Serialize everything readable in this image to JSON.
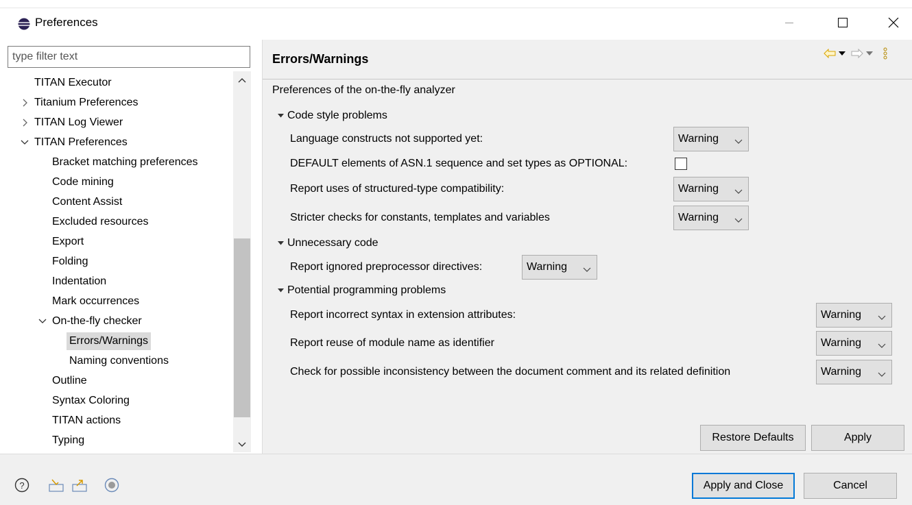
{
  "window": {
    "title": "Preferences",
    "icon": "eclipse-icon",
    "controls": [
      "minimize-icon",
      "maximize-icon",
      "close-icon"
    ]
  },
  "filter": {
    "placeholder": "type filter text",
    "value": ""
  },
  "tree": {
    "items": [
      {
        "label": "TITAN Executor",
        "level": 1,
        "twisty": "none"
      },
      {
        "label": "Titanium Preferences",
        "level": 1,
        "twisty": "collapsed"
      },
      {
        "label": "TITAN Log Viewer",
        "level": 1,
        "twisty": "collapsed"
      },
      {
        "label": "TITAN Preferences",
        "level": 1,
        "twisty": "expanded"
      },
      {
        "label": "Bracket matching preferences",
        "level": 2,
        "twisty": "none"
      },
      {
        "label": "Code mining",
        "level": 2,
        "twisty": "none"
      },
      {
        "label": "Content Assist",
        "level": 2,
        "twisty": "none"
      },
      {
        "label": "Excluded resources",
        "level": 2,
        "twisty": "none"
      },
      {
        "label": "Export",
        "level": 2,
        "twisty": "none"
      },
      {
        "label": "Folding",
        "level": 2,
        "twisty": "none"
      },
      {
        "label": "Indentation",
        "level": 2,
        "twisty": "none"
      },
      {
        "label": "Mark occurrences",
        "level": 2,
        "twisty": "none"
      },
      {
        "label": "On-the-fly checker",
        "level": 2,
        "twisty": "expanded"
      },
      {
        "label": "Errors/Warnings",
        "level": 3,
        "twisty": "none",
        "selected": true
      },
      {
        "label": "Naming conventions",
        "level": 3,
        "twisty": "none"
      },
      {
        "label": "Outline",
        "level": 2,
        "twisty": "none"
      },
      {
        "label": "Syntax Coloring",
        "level": 2,
        "twisty": "none"
      },
      {
        "label": "TITAN actions",
        "level": 2,
        "twisty": "none"
      },
      {
        "label": "Typing",
        "level": 2,
        "twisty": "none"
      }
    ]
  },
  "page": {
    "title": "Errors/Warnings",
    "description": "Preferences of the on-the-fly analyzer",
    "nav_icons": [
      "back-arrow-icon",
      "back-menu-icon",
      "forward-arrow-icon",
      "forward-menu-icon",
      "view-menu-icon"
    ],
    "sections": [
      {
        "title": "Code style problems",
        "settings": [
          {
            "label": "Language constructs not supported yet:",
            "type": "combo",
            "value": "Warning"
          },
          {
            "label": "DEFAULT elements of ASN.1 sequence and set types as OPTIONAL:",
            "type": "checkbox",
            "checked": false
          },
          {
            "label": "Report uses of structured-type compatibility:",
            "type": "combo",
            "value": "Warning"
          },
          {
            "label": "Stricter checks for constants, templates and variables",
            "type": "combo",
            "value": "Warning"
          }
        ]
      },
      {
        "title": "Unnecessary code",
        "settings": [
          {
            "label": "Report ignored preprocessor directives:",
            "type": "combo",
            "value": "Warning"
          }
        ]
      },
      {
        "title": "Potential programming problems",
        "settings": [
          {
            "label": "Report incorrect syntax in extension attributes:",
            "type": "combo",
            "value": "Warning"
          },
          {
            "label": "Report reuse of module name as identifier",
            "type": "combo",
            "value": "Warning"
          },
          {
            "label": "Check for possible inconsistency between the document comment and its related definition",
            "type": "combo",
            "value": "Warning"
          }
        ]
      }
    ],
    "restore_defaults_label": "Restore Defaults",
    "apply_label": "Apply"
  },
  "footer": {
    "icons": [
      "help-icon",
      "import-icon",
      "export-icon",
      "record-icon"
    ],
    "apply_close_label": "Apply and Close",
    "cancel_label": "Cancel"
  }
}
